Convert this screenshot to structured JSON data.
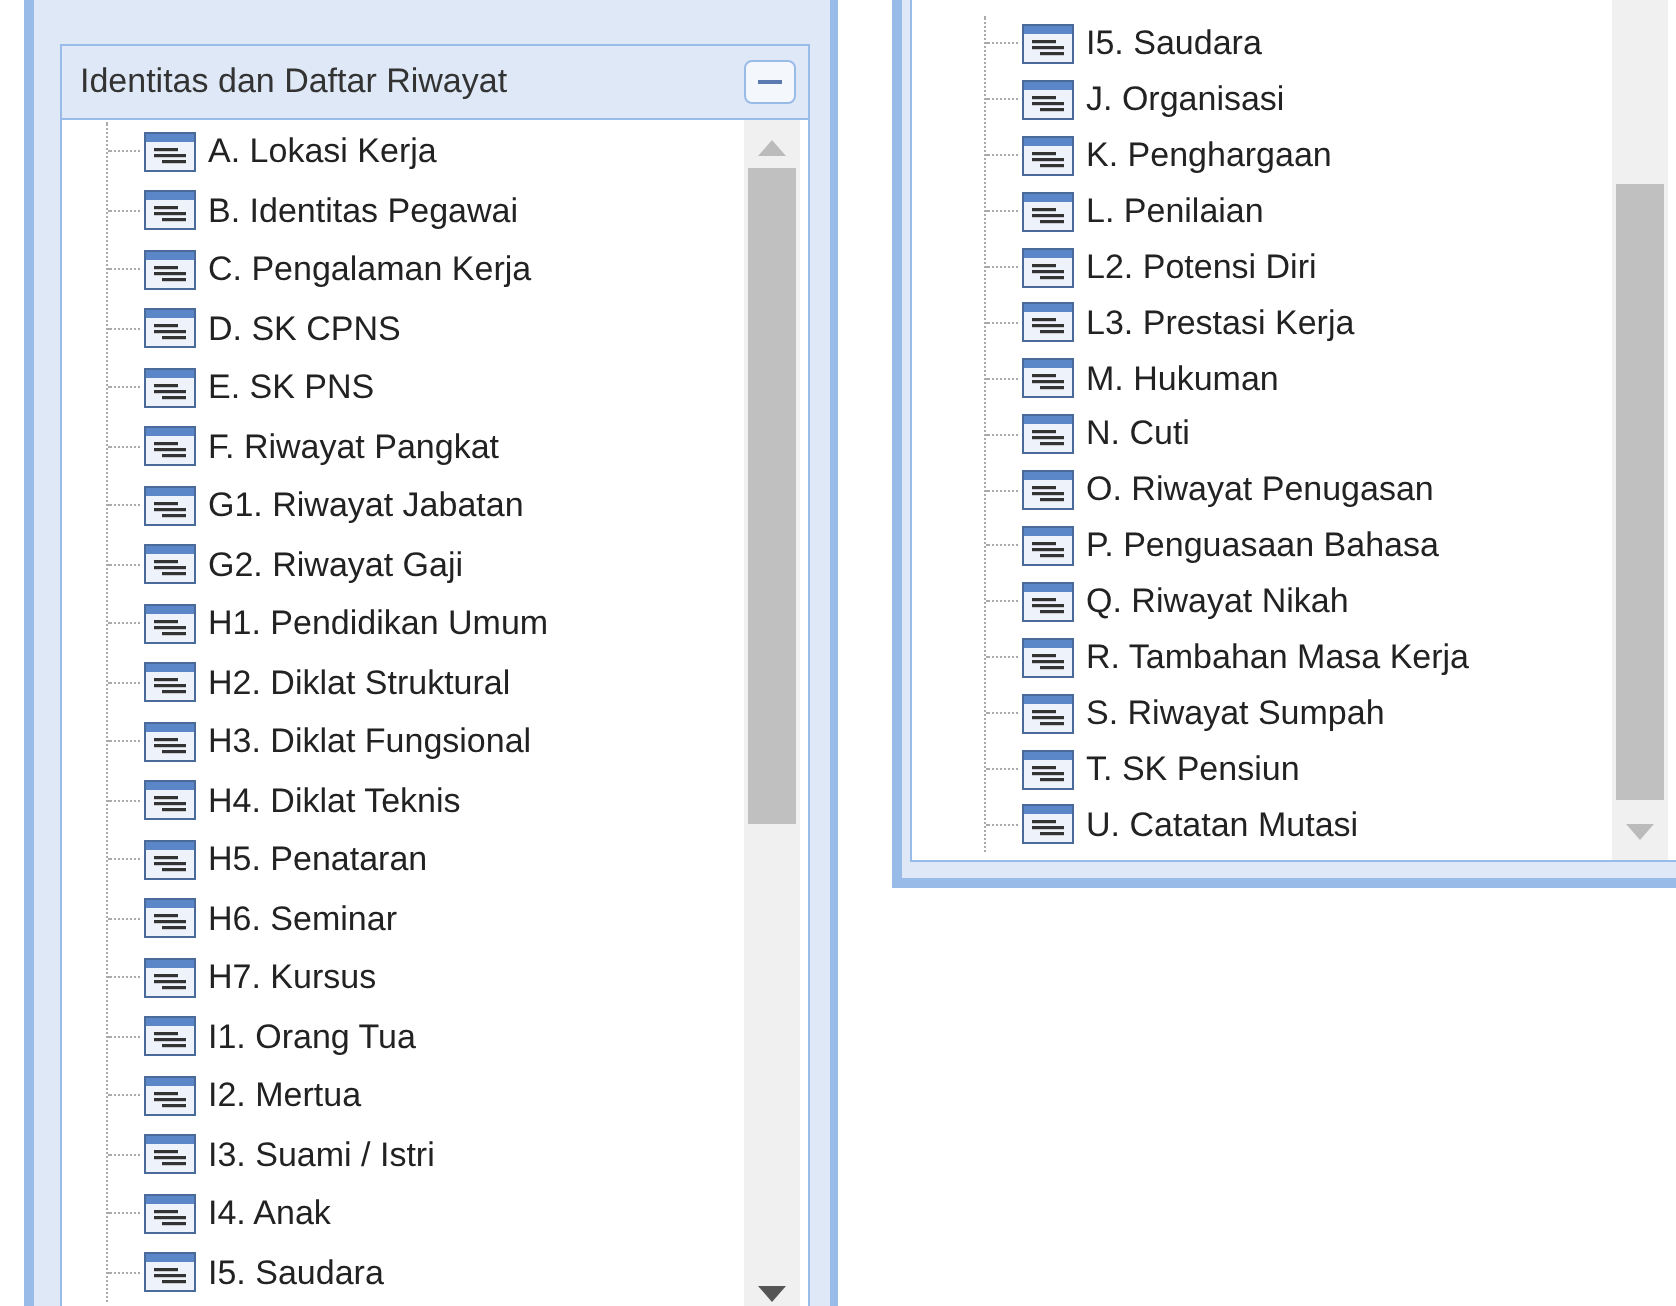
{
  "left_panel": {
    "title": "Identitas dan Daftar Riwayat",
    "items": [
      {
        "label": "A. Lokasi Kerja"
      },
      {
        "label": "B. Identitas Pegawai"
      },
      {
        "label": "C. Pengalaman Kerja"
      },
      {
        "label": "D. SK CPNS"
      },
      {
        "label": "E. SK PNS"
      },
      {
        "label": "F. Riwayat Pangkat"
      },
      {
        "label": "G1. Riwayat Jabatan"
      },
      {
        "label": "G2. Riwayat Gaji"
      },
      {
        "label": "H1. Pendidikan Umum"
      },
      {
        "label": "H2. Diklat Struktural"
      },
      {
        "label": "H3. Diklat Fungsional"
      },
      {
        "label": "H4. Diklat Teknis"
      },
      {
        "label": "H5. Penataran"
      },
      {
        "label": "H6. Seminar"
      },
      {
        "label": "H7. Kursus"
      },
      {
        "label": "I1. Orang Tua"
      },
      {
        "label": "I2. Mertua"
      },
      {
        "label": "I3. Suami / Istri"
      },
      {
        "label": "I4. Anak"
      },
      {
        "label": "I5. Saudara"
      }
    ]
  },
  "right_panel": {
    "items": [
      {
        "label": "I5. Saudara"
      },
      {
        "label": "J. Organisasi"
      },
      {
        "label": "K. Penghargaan"
      },
      {
        "label": "L. Penilaian"
      },
      {
        "label": "L2. Potensi Diri"
      },
      {
        "label": "L3. Prestasi Kerja"
      },
      {
        "label": "M. Hukuman"
      },
      {
        "label": "N. Cuti"
      },
      {
        "label": "O. Riwayat Penugasan"
      },
      {
        "label": "P. Penguasaan Bahasa"
      },
      {
        "label": "Q. Riwayat Nikah"
      },
      {
        "label": "R. Tambahan Masa Kerja"
      },
      {
        "label": "S. Riwayat Sumpah"
      },
      {
        "label": "T. SK Pensiun"
      },
      {
        "label": "U. Catatan Mutasi"
      }
    ]
  }
}
